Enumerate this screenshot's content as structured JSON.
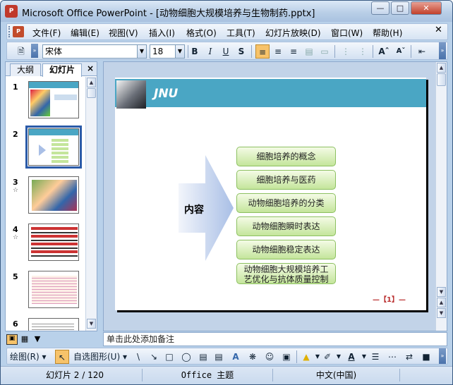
{
  "window": {
    "title": "Microsoft Office PowerPoint - [动物细胞大规模培养与生物制药.pptx]"
  },
  "menu": [
    "文件(F)",
    "编辑(E)",
    "视图(V)",
    "插入(I)",
    "格式(O)",
    "工具(T)",
    "幻灯片放映(D)",
    "窗口(W)",
    "帮助(H)"
  ],
  "formatting": {
    "font": "宋体",
    "size": "18"
  },
  "pane": {
    "tabs": [
      "大纲",
      "幻灯片"
    ],
    "active_tab": "幻灯片",
    "close": "×"
  },
  "thumbnails": [
    {
      "num": "1",
      "anim": ""
    },
    {
      "num": "2",
      "anim": ""
    },
    {
      "num": "3",
      "anim": "☆"
    },
    {
      "num": "4",
      "anim": "☆"
    },
    {
      "num": "5",
      "anim": ""
    },
    {
      "num": "6",
      "anim": ""
    }
  ],
  "slide": {
    "header": "JNU",
    "center_label": "内容",
    "items": [
      "细胞培养的概念",
      "细胞培养与医药",
      "动物细胞培养的分类",
      "动物细胞瞬时表达",
      "动物细胞稳定表达",
      "动物细胞大规模培养工艺优化与抗体质量控制"
    ],
    "page": "—【1】—"
  },
  "notes": {
    "placeholder": "单击此处添加备注"
  },
  "drawing": {
    "draw_label": "绘图(R)",
    "autoshape_label": "自选图形(U)"
  },
  "status": {
    "slide_info": "幻灯片 2 / 120",
    "theme": "Office 主题",
    "language": "中文(中国)"
  },
  "colors": {
    "header": "#4aa6c4",
    "item_fill": "#c4e59b",
    "item_border": "#8cc060",
    "arrow": "#a9bfe6",
    "selection": "#2a5aa8"
  }
}
